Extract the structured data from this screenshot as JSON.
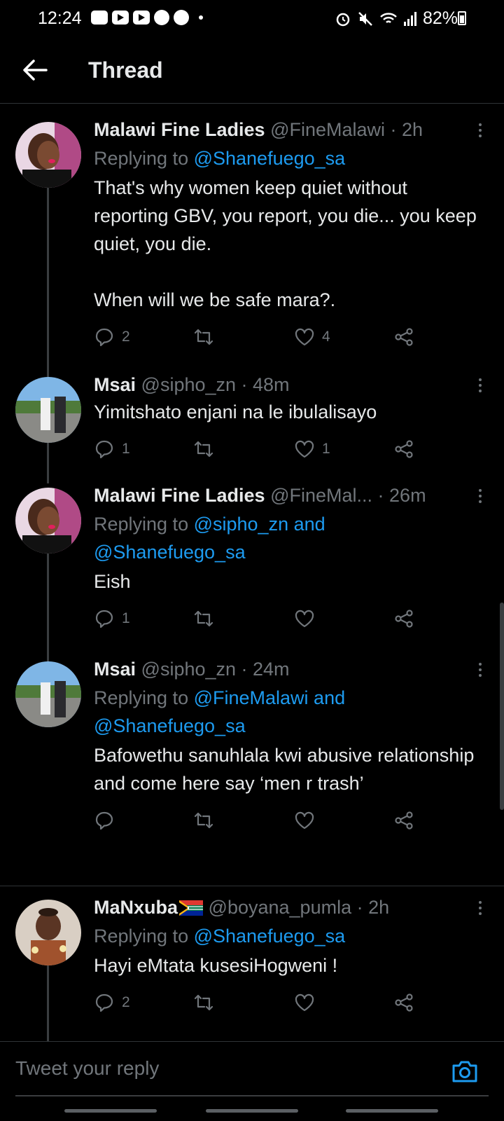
{
  "status_bar": {
    "time": "12:24",
    "battery": "82%"
  },
  "header": {
    "title": "Thread"
  },
  "tweets": [
    {
      "name": "Malawi Fine Ladies",
      "meta": "@FineMalawi · 2h",
      "reply_prefix": "Replying to ",
      "reply_mentions": "@Shanefuego_sa",
      "reply_line2": "",
      "text": "That's why women keep quiet without reporting GBV, you report, you die... you keep quiet, you die.\n\nWhen will we be safe mara?.",
      "reply_count": "2",
      "like_count": "4"
    },
    {
      "name": "Msai",
      "meta": "@sipho_zn · 48m",
      "reply_prefix": "",
      "reply_mentions": "",
      "reply_line2": "",
      "text": "Yimitshato enjani na le ibulalisayo",
      "reply_count": "1",
      "like_count": "1"
    },
    {
      "name": "Malawi Fine Ladies",
      "meta": "@FineMal...  · 26m",
      "reply_prefix": "Replying to ",
      "reply_mentions": "@sipho_zn and",
      "reply_line2": "@Shanefuego_sa",
      "text": "Eish",
      "reply_count": "1",
      "like_count": ""
    },
    {
      "name": "Msai",
      "meta": "@sipho_zn · 24m",
      "reply_prefix": "Replying to ",
      "reply_mentions": "@FineMalawi and",
      "reply_line2": "@Shanefuego_sa",
      "text": "Bafowethu sanuhlala kwi abusive relationship and come here say ‘men r trash’",
      "reply_count": "",
      "like_count": ""
    },
    {
      "name": "MaNxuba",
      "meta": "@boyana_pumla · 2h",
      "reply_prefix": "Replying to ",
      "reply_mentions": "@Shanefuego_sa",
      "reply_line2": "",
      "text": "Hayi eMtata kusesiHogweni !",
      "reply_count": "2",
      "like_count": ""
    }
  ],
  "reply_bar": {
    "placeholder": "Tweet your reply"
  },
  "icons": [
    "back-arrow-icon",
    "more-icon",
    "reply-icon",
    "retweet-icon",
    "like-icon",
    "share-icon",
    "camera-icon",
    "south-africa-flag-icon"
  ],
  "colors": {
    "background": "#000000",
    "text": "#e7e9ea",
    "muted": "#71767b",
    "accent": "#1d9bf0"
  }
}
